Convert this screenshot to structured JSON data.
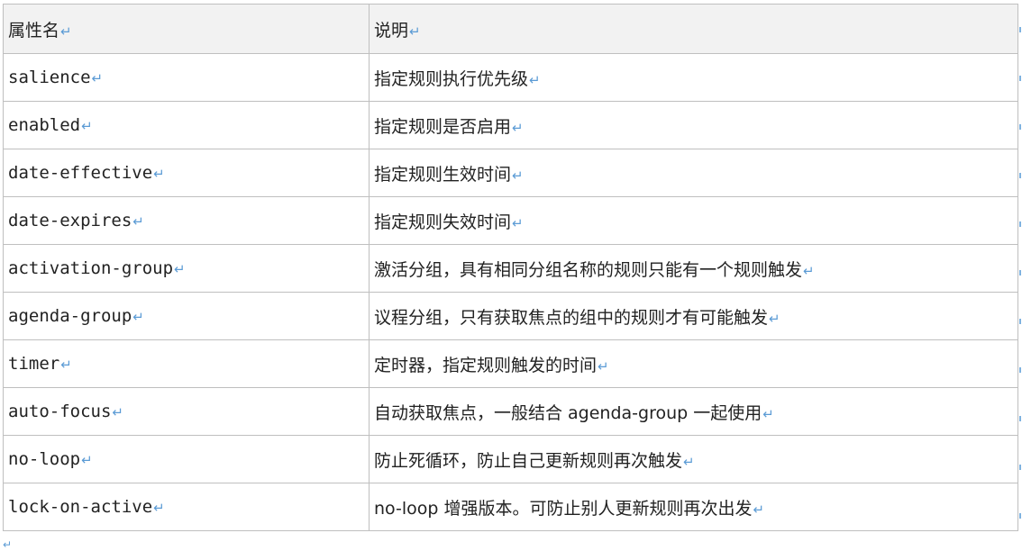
{
  "paragraph_mark": "↵",
  "table": {
    "headers": [
      "属性名",
      "说明"
    ],
    "rows": [
      {
        "name": "salience",
        "desc": "指定规则执行优先级"
      },
      {
        "name": "enabled",
        "desc": "指定规则是否启用"
      },
      {
        "name": "date-effective",
        "desc": "指定规则生效时间"
      },
      {
        "name": "date-expires",
        "desc": "指定规则失效时间"
      },
      {
        "name": "activation-group",
        "desc": "激活分组，具有相同分组名称的规则只能有一个规则触发"
      },
      {
        "name": "agenda-group",
        "desc": "议程分组，只有获取焦点的组中的规则才有可能触发"
      },
      {
        "name": "timer",
        "desc": "定时器，指定规则触发的时间"
      },
      {
        "name": "auto-focus",
        "desc": "自动获取焦点，一般结合 agenda-group 一起使用"
      },
      {
        "name": "no-loop",
        "desc": "防止死循环，防止自己更新规则再次触发"
      },
      {
        "name": "lock-on-active",
        "desc": "no-loop 增强版本。可防止别人更新规则再次出发"
      }
    ]
  },
  "colors": {
    "border": "#bfbfbf",
    "header_bg": "#f2f2f2",
    "mark": "#5b9bd5"
  }
}
